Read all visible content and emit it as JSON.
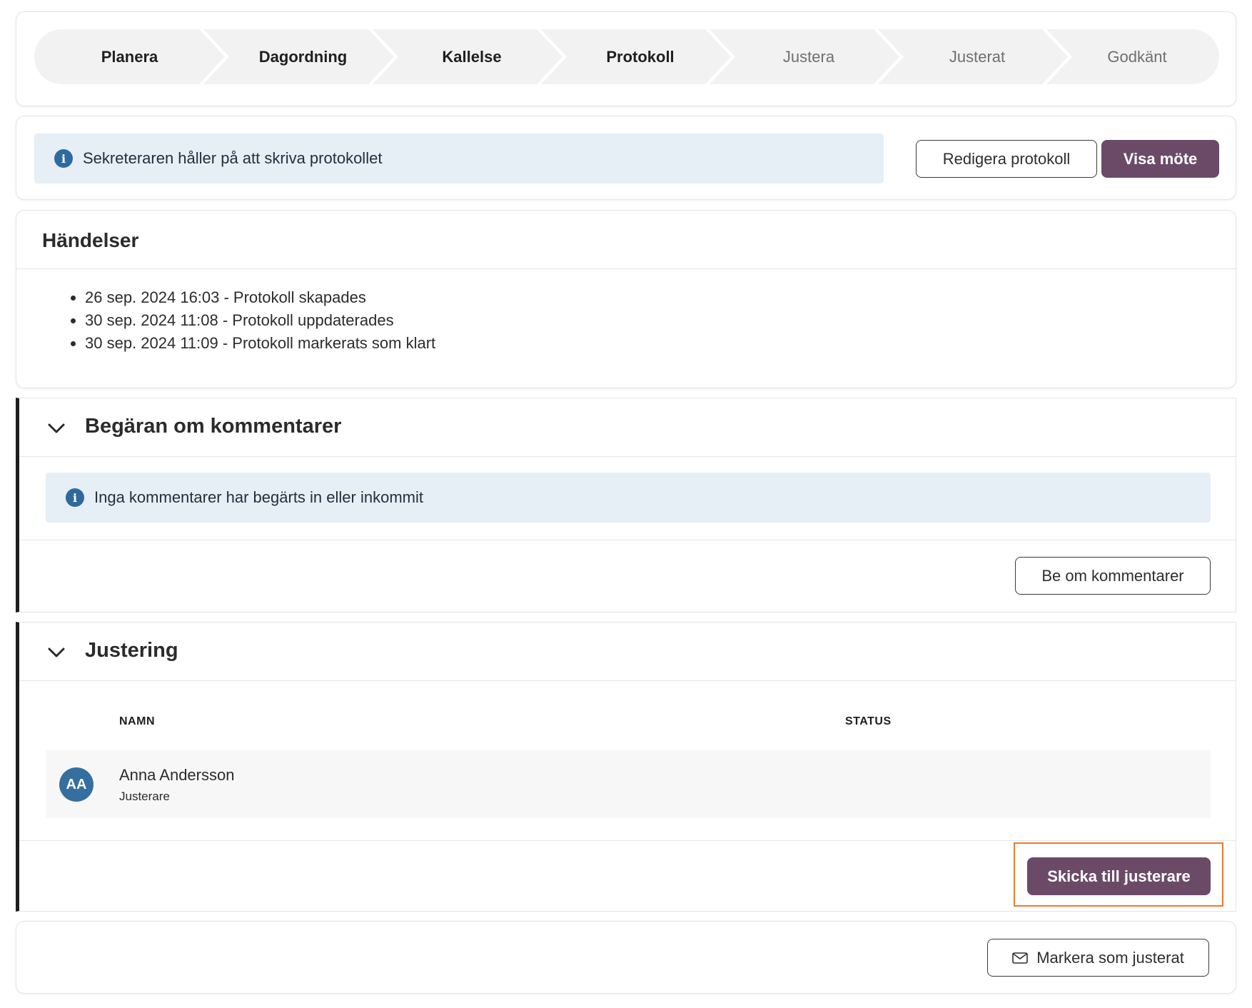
{
  "stepper": {
    "steps": [
      {
        "label": "Planera",
        "state": "done"
      },
      {
        "label": "Dagordning",
        "state": "done"
      },
      {
        "label": "Kallelse",
        "state": "done"
      },
      {
        "label": "Protokoll",
        "state": "done"
      },
      {
        "label": "Justera",
        "state": "todo"
      },
      {
        "label": "Justerat",
        "state": "todo"
      },
      {
        "label": "Godkänt",
        "state": "todo"
      }
    ]
  },
  "status": {
    "message": "Sekreteraren håller på att skriva protokollet",
    "icon": "info-icon",
    "edit_button": "Redigera protokoll",
    "view_button": "Visa möte"
  },
  "events": {
    "title": "Händelser",
    "items": [
      "26 sep. 2024 16:03 - Protokoll skapades",
      "30 sep. 2024 11:08 - Protokoll uppdaterades",
      "30 sep. 2024 11:09 - Protokoll markerats som klart"
    ]
  },
  "comments": {
    "title": "Begäran om kommentarer",
    "info": "Inga kommentarer har begärts in eller inkommit",
    "request_button": "Be om kommentarer"
  },
  "adjustment": {
    "title": "Justering",
    "columns": {
      "name": "NAMN",
      "status": "STATUS"
    },
    "rows": [
      {
        "initials": "AA",
        "name": "Anna Andersson",
        "role": "Justerare",
        "status": ""
      }
    ],
    "send_button": "Skicka till justerare"
  },
  "final": {
    "mark_button": "Markera som justerat",
    "icon": "mail-icon"
  },
  "colors": {
    "primary": "#6b4a68",
    "info_bg": "#e6eef6",
    "info_icon": "#2f6a9e",
    "avatar": "#346f9f",
    "highlight": "#ea7b32"
  }
}
